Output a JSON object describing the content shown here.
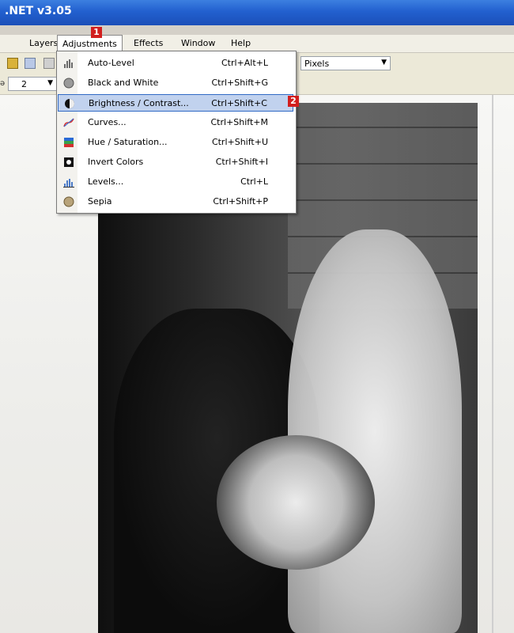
{
  "window": {
    "title": ".NET v3.05"
  },
  "menubar": {
    "items": [
      "Layers",
      "Adjustments",
      "Effects",
      "Window",
      "Help"
    ]
  },
  "toolbar": {
    "units_value": "Pixels",
    "brush_size": "2"
  },
  "adjustments_menu": {
    "items": [
      {
        "label": "Auto-Level",
        "shortcut": "Ctrl+Alt+L",
        "icon": "histogram-icon"
      },
      {
        "label": "Black and White",
        "shortcut": "Ctrl+Shift+G",
        "icon": "grey-sphere-icon"
      },
      {
        "label": "Brightness / Contrast...",
        "shortcut": "Ctrl+Shift+C",
        "icon": "brightness-icon",
        "highlighted": true
      },
      {
        "label": "Curves...",
        "shortcut": "Ctrl+Shift+M",
        "icon": "curves-icon"
      },
      {
        "label": "Hue / Saturation...",
        "shortcut": "Ctrl+Shift+U",
        "icon": "hue-saturation-icon"
      },
      {
        "label": "Invert Colors",
        "shortcut": "Ctrl+Shift+I",
        "icon": "invert-icon"
      },
      {
        "label": "Levels...",
        "shortcut": "Ctrl+L",
        "icon": "levels-icon"
      },
      {
        "label": "Sepia",
        "shortcut": "Ctrl+Shift+P",
        "icon": "sepia-sphere-icon"
      }
    ]
  },
  "callouts": {
    "one": "1",
    "two": "2"
  },
  "colors": {
    "titlebar": "#2260cf",
    "highlight": "#c1d2ee",
    "highlight_border": "#316ac5",
    "badge": "#d21e1e"
  }
}
